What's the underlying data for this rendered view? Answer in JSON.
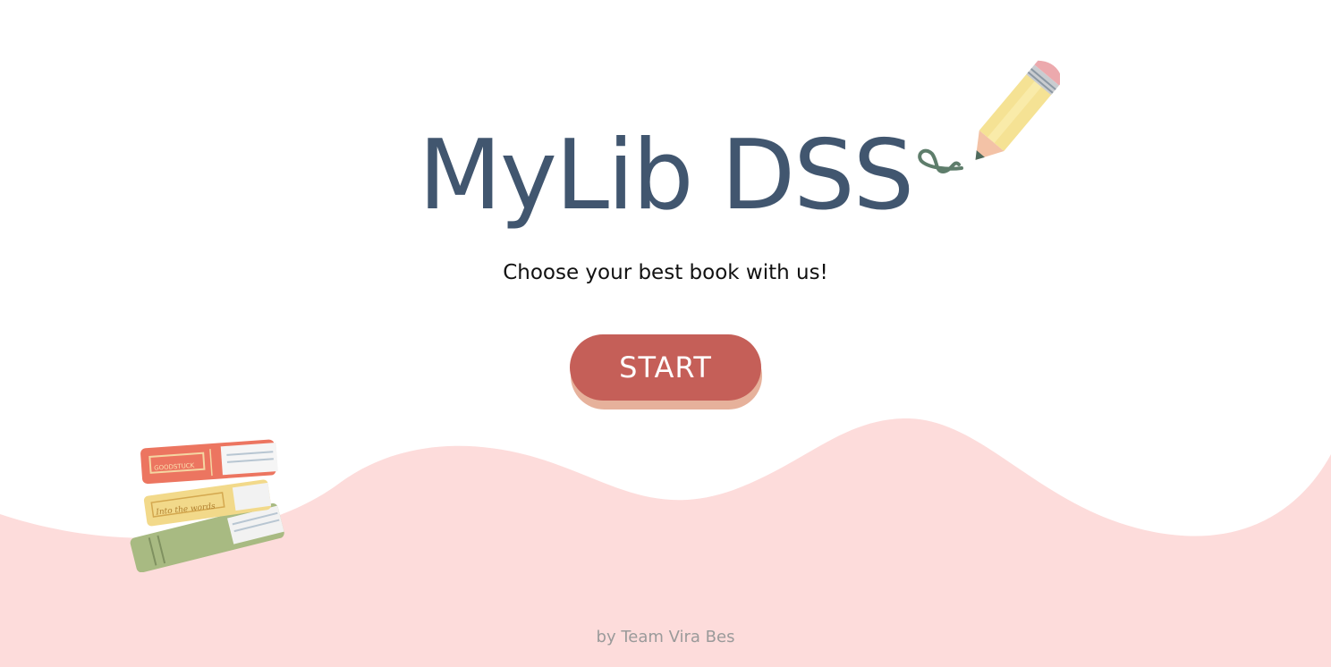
{
  "app": {
    "title": "MyLib DSS",
    "tagline": "Choose your best book with us!",
    "start_label": "START",
    "footer": "by Team Vira Bes"
  },
  "decorations": {
    "pencil_icon": "pencil-icon",
    "books_icon": "book-stack-icon",
    "book_spine_labels": [
      "GOODSTUCK",
      "Into the words"
    ]
  },
  "colors": {
    "title": "#41566f",
    "button": "#c55f58",
    "button_shadow": "#e6b19b",
    "wave": "#fddcdb",
    "footer_text": "#9a9a9a"
  }
}
